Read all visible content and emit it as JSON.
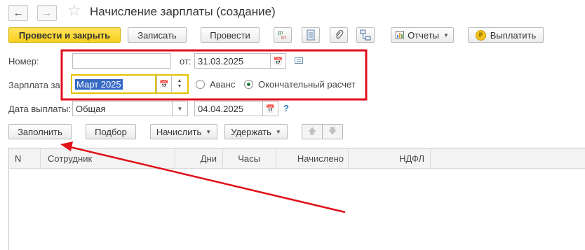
{
  "window": {
    "title": "Начисление зарплаты (создание)"
  },
  "nav": {
    "back_icon": "arrow-left-icon",
    "forward_icon": "arrow-right-icon",
    "favorite_icon": "star-icon"
  },
  "toolbar": {
    "post_close_label": "Провести и закрыть",
    "save_label": "Записать",
    "post_label": "Провести",
    "reports_label": "Отчеты",
    "pay_label": "Выплатить",
    "dtkt_top": "Дт",
    "dtkt_bottom": "Кт"
  },
  "form": {
    "number_label": "Номер:",
    "number_value": "",
    "date_from_label": "от:",
    "date_from_value": "31.03.2025",
    "salary_for_label": "Зарплата за:",
    "salary_for_value": "Март 2025",
    "advance_label": "Аванс",
    "final_label": "Окончательный расчет",
    "selected_option": "final",
    "pay_date_label": "Дата выплаты:",
    "pay_date_type": "Общая",
    "pay_date_value": "04.04.2025",
    "help_label": "?"
  },
  "table_toolbar": {
    "fill_label": "Заполнить",
    "select_label": "Подбор",
    "accrue_label": "Начислить",
    "withhold_label": "Удержать"
  },
  "table": {
    "columns": [
      "N",
      "Сотрудник",
      "Дни",
      "Часы",
      "Начислено",
      "НДФЛ"
    ],
    "rows": []
  },
  "annotations": {
    "highlight_color": "#e0101a",
    "arrow_color": "#e0101a"
  },
  "colors": {
    "primary_button": "#f7cf1e",
    "focus_border": "#e6c100",
    "selection_bg": "#3569c4",
    "radio_dot": "#2a7d3a",
    "help_color": "#2a7bc4"
  }
}
